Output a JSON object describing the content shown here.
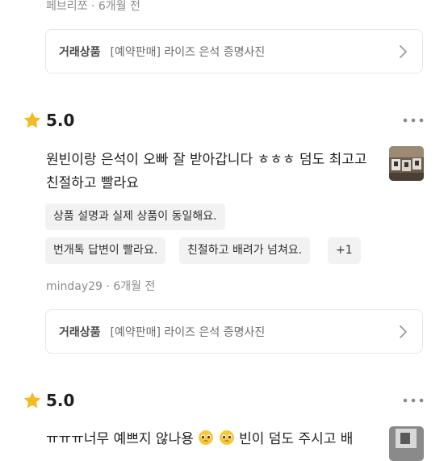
{
  "reviews": [
    {
      "author": "페브리쪼",
      "age": "6개월 전",
      "product_label": "거래상품",
      "product_name": "[예약판매] 라이즈 은석 증명사진"
    },
    {
      "rating": "5.0",
      "text": "원빈이랑 은석이 오빠 잘 받아갑니다 ㅎㅎㅎ 덤도 최고고 친절하고 빨라요",
      "tags": [
        "상품 설명과 실제 상품이 동일해요.",
        "번개톡 답변이 빨라요.",
        "친절하고 배려가 넘쳐요."
      ],
      "more_tags": "+1",
      "author": "minday29",
      "age": "6개월 전",
      "product_label": "거래상품",
      "product_name": "[예약판매] 라이즈 은석 증명사진"
    },
    {
      "rating": "5.0",
      "text_part1": "ㅠㅠㅠ너무 예쁘지 않나용",
      "text_part2": "빈이 덤도 주시고 배"
    }
  ],
  "icons": {
    "star": "star-icon",
    "more": "more-options-icon",
    "chevron": "chevron-right-icon",
    "emoji": "pleading-face-icon"
  },
  "colors": {
    "star": "#F5B921",
    "meta": "#8C8C8C",
    "chip_bg": "#F2F2F2"
  }
}
